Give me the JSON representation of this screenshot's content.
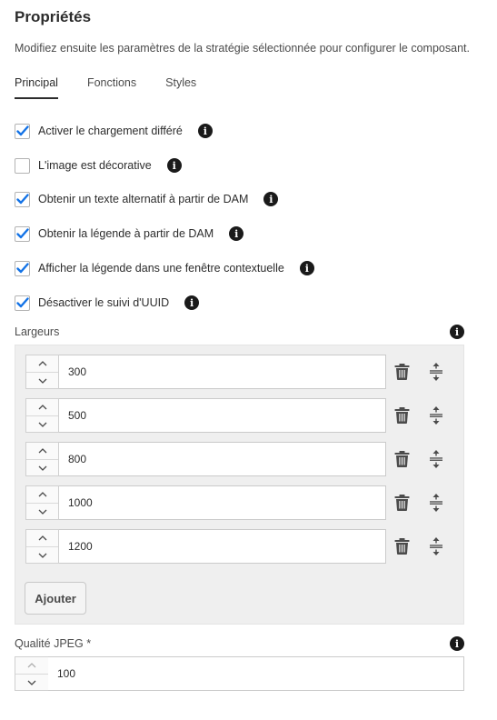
{
  "header": {
    "title": "Propriétés",
    "description": "Modifiez ensuite les paramètres de la stratégie sélectionnée pour configurer le composant."
  },
  "tabs": [
    {
      "label": "Principal",
      "active": true
    },
    {
      "label": "Fonctions",
      "active": false
    },
    {
      "label": "Styles",
      "active": false
    }
  ],
  "checkboxes": [
    {
      "label": "Activer le chargement différé",
      "checked": true
    },
    {
      "label": "L'image est décorative",
      "checked": false
    },
    {
      "label": "Obtenir un texte alternatif à partir de DAM",
      "checked": true
    },
    {
      "label": "Obtenir la légende à partir de DAM",
      "checked": true
    },
    {
      "label": "Afficher la légende dans une fenêtre contextuelle",
      "checked": true
    },
    {
      "label": "Désactiver le suivi d'UUID",
      "checked": true
    }
  ],
  "widths": {
    "label": "Largeurs",
    "items": [
      "300",
      "500",
      "800",
      "1000",
      "1200"
    ],
    "add_label": "Ajouter"
  },
  "jpeg": {
    "label": "Qualité JPEG *",
    "value": "100"
  },
  "icons": {
    "info": "info-icon",
    "checkmark": "checkmark-icon",
    "trash": "trash-icon",
    "reorder": "reorder-icon",
    "chevron_up": "chevron-up-icon",
    "chevron_down": "chevron-down-icon"
  },
  "colors": {
    "checkmark": "#1473e6",
    "text": "#2c2c2c",
    "panel_bg": "#efefef"
  }
}
